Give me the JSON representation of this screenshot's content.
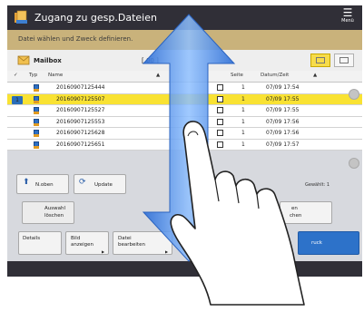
{
  "title": "Zugang zu gesp.Dateien",
  "menu_label": "Menü",
  "instruction": "Datei wählen und Zweck definieren.",
  "mailbox": {
    "name": "Mailbox",
    "number": "[ 00 ]"
  },
  "columns": {
    "check": "✓",
    "type": "Typ",
    "name": "Name",
    "pages": "Seite",
    "date": "Datum/Zeit"
  },
  "rows": [
    {
      "name": "20160907125444",
      "pages": "1",
      "date": "07/09 17:54",
      "selected": false,
      "badge": ""
    },
    {
      "name": "20160907125507",
      "pages": "1",
      "date": "07/09 17:55",
      "selected": true,
      "badge": "1"
    },
    {
      "name": "20160907125527",
      "pages": "1",
      "date": "07/09 17:55",
      "selected": false,
      "badge": ""
    },
    {
      "name": "20160907125553",
      "pages": "1",
      "date": "07/09 17:56",
      "selected": false,
      "badge": ""
    },
    {
      "name": "20160907125628",
      "pages": "1",
      "date": "07/09 17:56",
      "selected": false,
      "badge": ""
    },
    {
      "name": "20160907125651",
      "pages": "1",
      "date": "07/09 17:57",
      "selected": false,
      "badge": ""
    }
  ],
  "selected_count_label": "Gewählt: 1",
  "buttons": {
    "up": "N.oben",
    "update": "Update",
    "clear_selection_line1": "Auswahl",
    "clear_selection_line2": "löschen",
    "delete_line1": "en",
    "delete_line2": "chen",
    "details": "Details",
    "show_image_line1": "Bild",
    "show_image_line2": "anzeigen",
    "edit_file_line1": "Datei",
    "edit_file_line2": "bearbeiten",
    "print": "ruck"
  },
  "colors": {
    "title_bar": "#302f37",
    "instruction_bar": "#c9b27b",
    "selected_row": "#f9e233",
    "arrow_blue": "#3b86e8",
    "action_blue": "#2d72c9"
  },
  "overlay": {
    "arrow": "vertical-double-arrow",
    "gesture": "hand-swipe-icon"
  }
}
